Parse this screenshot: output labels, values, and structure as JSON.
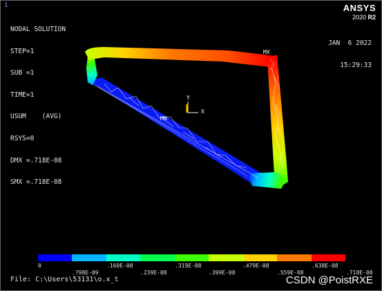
{
  "window_number": "1",
  "title": "NODAL SOLUTION",
  "info_lines": [
    "STEP=1",
    "SUB =1",
    "TIME=1",
    "USUM    (AVG)",
    "RSYS=0",
    "DMX =.718E-08",
    "SMX =.718E-08"
  ],
  "brand": {
    "name": "ANSYS",
    "version_year": "2020",
    "version_release": "R2"
  },
  "date": "JAN  6 2022",
  "time": "15:29:33",
  "markers": {
    "max": "MX",
    "min": "MN"
  },
  "triad": {
    "y": "Y",
    "x": "X"
  },
  "colorbar": {
    "colors": [
      "#0000ff",
      "#00b4ff",
      "#00ffc8",
      "#00ff50",
      "#3cff00",
      "#c8ff00",
      "#ffd200",
      "#ff7800",
      "#ff0000"
    ],
    "labels_top": [
      "0",
      ".160E-08",
      ".319E-08",
      ".479E-08",
      ".638E-08"
    ],
    "labels_bottom": [
      ".798E-09",
      ".239E-08",
      ".399E-08",
      ".559E-08",
      ".718E-08"
    ]
  },
  "file_line": "File: C:\\Users\\53131\\o.x_t",
  "watermark": "CSDN @PoistRXE"
}
